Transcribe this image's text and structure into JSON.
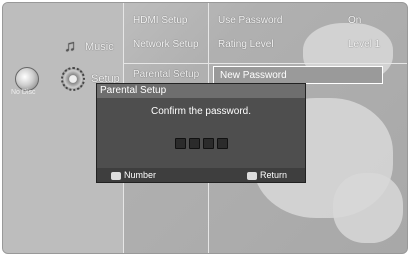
{
  "nav": {
    "music_label": "Music",
    "setup_label": "Setup",
    "disc_label": "No Disc"
  },
  "top_menu": {
    "row1": [
      "HDMI Setup",
      "Use Password",
      "On"
    ],
    "row2": [
      "Network Setup",
      "Rating Level",
      "Level 1"
    ],
    "current": "Parental Setup",
    "selected": "New Password"
  },
  "dialog": {
    "title": "Parental Setup",
    "message": "Confirm the password.",
    "pin_length": 4,
    "footer": {
      "number_label": "Number",
      "return_label": "Return"
    }
  }
}
